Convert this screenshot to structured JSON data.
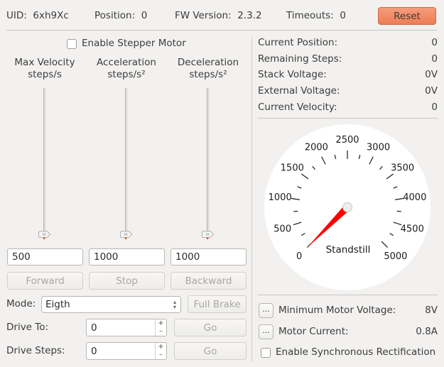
{
  "header": {
    "uid_label": "UID:",
    "uid_value": "6xh9Xc",
    "position_label": "Position:",
    "position_value": "0",
    "fw_label": "FW Version:",
    "fw_value": "2.3.2",
    "timeouts_label": "Timeouts:",
    "timeouts_value": "0",
    "reset_label": "Reset"
  },
  "left": {
    "enable_stepper_label": "Enable Stepper Motor",
    "enable_stepper_checked": false,
    "sliders": [
      {
        "title": "Max Velocity",
        "unit": "steps/s",
        "value": "500",
        "position": 0
      },
      {
        "title": "Acceleration",
        "unit": "steps/s²",
        "value": "1000",
        "position": 0
      },
      {
        "title": "Deceleration",
        "unit": "steps/s²",
        "value": "1000",
        "position": 0
      }
    ],
    "buttons": {
      "forward": "Forward",
      "stop": "Stop",
      "backward": "Backward",
      "full_brake": "Full Brake",
      "go": "Go"
    },
    "mode_label": "Mode:",
    "mode_value": "Eigth",
    "drive_to_label": "Drive To:",
    "drive_to_value": "0",
    "drive_steps_label": "Drive Steps:",
    "drive_steps_value": "0",
    "spin_up": "+",
    "spin_down": "–"
  },
  "right": {
    "status": [
      {
        "label": "Current Position:",
        "value": "0"
      },
      {
        "label": "Remaining Steps:",
        "value": "0"
      },
      {
        "label": "Stack Voltage:",
        "value": "0V"
      },
      {
        "label": "External Voltage:",
        "value": "0V"
      },
      {
        "label": "Current Velocity:",
        "value": "0"
      }
    ],
    "gauge": {
      "min": 0,
      "max": 5000,
      "value": 0,
      "labels": [
        "0",
        "500",
        "1000",
        "1500",
        "2000",
        "2500",
        "3000",
        "3500",
        "4000",
        "4500",
        "5000"
      ],
      "status_text": "Standstill",
      "needle_color": "#ff0000"
    },
    "min_motor_voltage_label": "Minimum Motor Voltage:",
    "min_motor_voltage_value": "8V",
    "motor_current_label": "Motor Current:",
    "motor_current_value": "0.8A",
    "ellipsis": "...",
    "sync_rect_label": "Enable Synchronous Rectification",
    "sync_rect_checked": false
  },
  "colors": {
    "reset_bg": "#ee7c55",
    "slider_marker": "#e0501e",
    "background": "#f2f1f0"
  }
}
